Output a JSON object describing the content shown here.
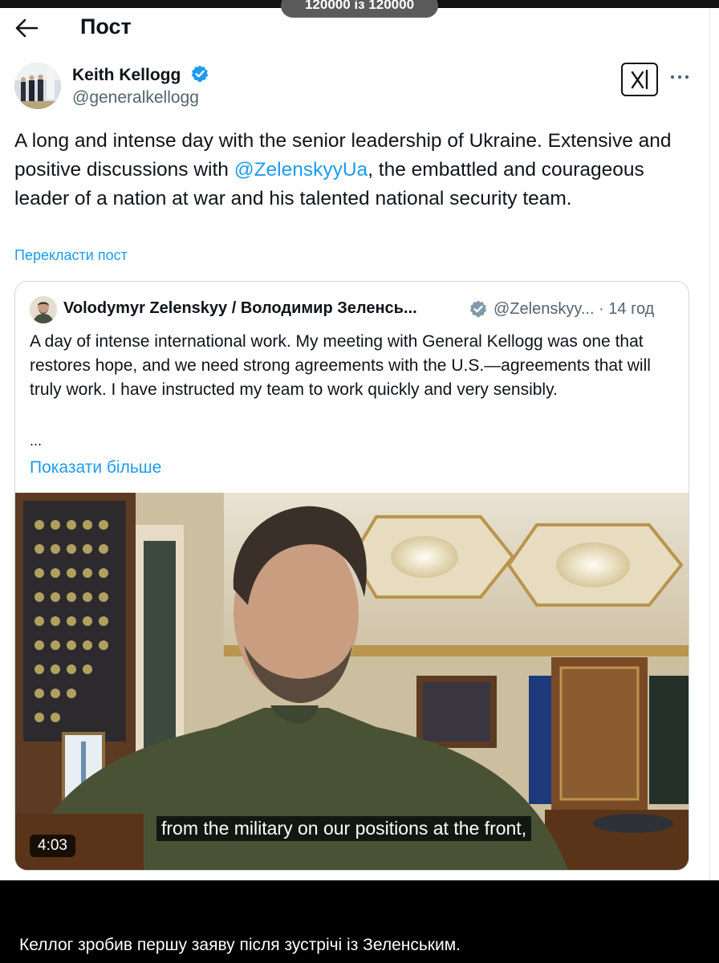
{
  "viewer": {
    "counter": "120000 із 120000"
  },
  "header": {
    "title": "Пост"
  },
  "post": {
    "author_name": "Keith Kellogg",
    "author_handle": "@generalkellogg",
    "text_before_mention": "A long and intense day with the senior leadership of Ukraine.  Extensive and positive discussions with ",
    "mention": "@ZelenskyyUa",
    "text_after_mention": ", the embattled and courageous leader of a nation at war and his talented national security team.",
    "translate_link": "Перекласти пост"
  },
  "quote": {
    "author_name": "Volodymyr Zelenskyy / Володимир Зеленсь...",
    "handle_time": "@Zelenskyy... · 14 год",
    "text": "A day of intense international work. My meeting with General Kellogg was one that restores hope, and we need strong agreements with the U.S.—agreements that will truly work. I have instructed my team to work quickly and very sensibly.",
    "ellipsis": "...",
    "show_more": "Показати більше",
    "video": {
      "subtitle": "from the military on our positions at the front,",
      "duration": "4:03"
    }
  },
  "caption": "Келлог зробив першу заяву після зустрічі із Зеленським.",
  "colors": {
    "accent": "#1d9bf0",
    "text": "#0f1419",
    "secondary": "#536471",
    "border": "#cfd9de"
  },
  "icons": [
    "back-arrow-icon",
    "verified-badge-icon",
    "grok-icon",
    "more-icon"
  ]
}
